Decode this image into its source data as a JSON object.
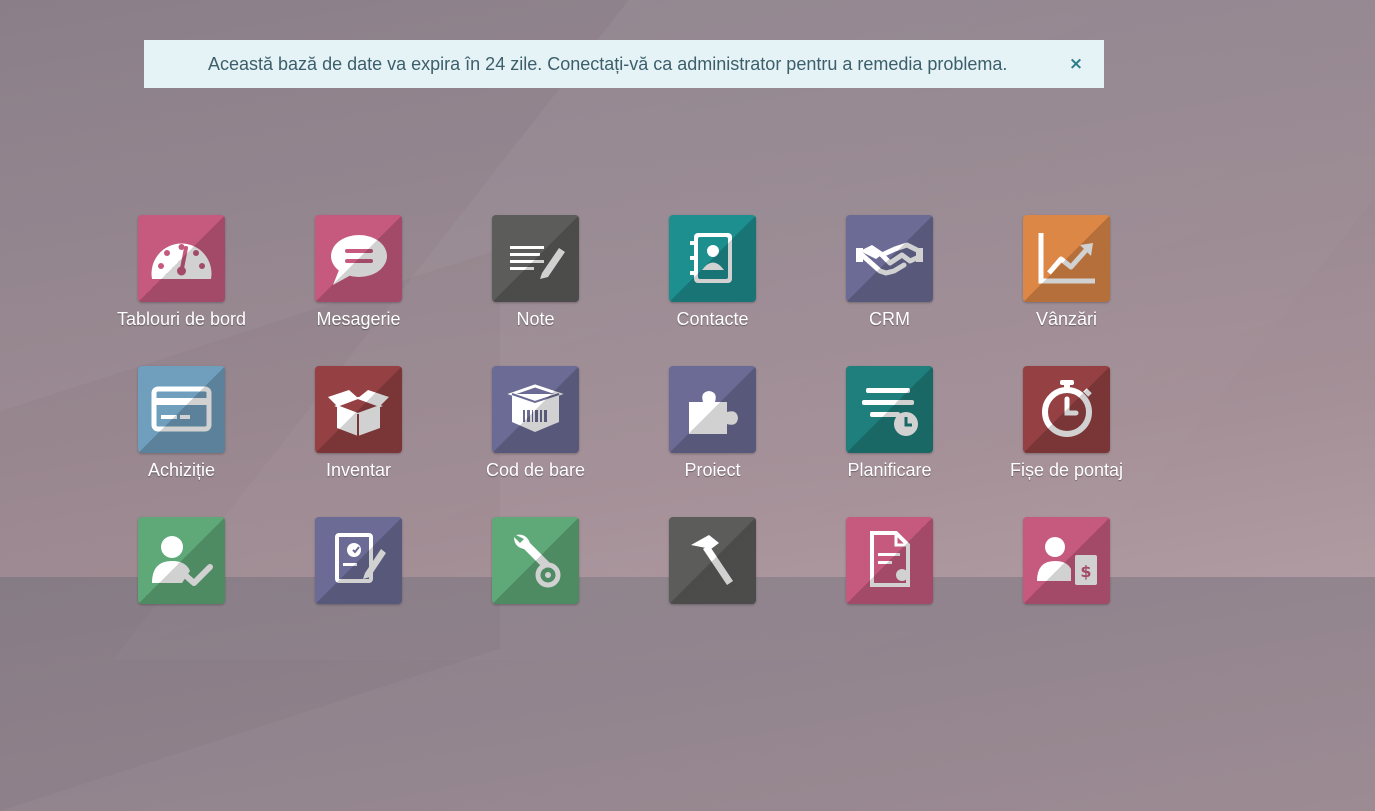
{
  "banner": {
    "message": "Această bază de date va expira în 24 zile. Conectați-vă ca administrator pentru a remedia problema.",
    "close_glyph": "×"
  },
  "apps": [
    {
      "label": "Tablouri de bord",
      "icon": "dashboard-gauge-icon",
      "color": "#c55a7e"
    },
    {
      "label": "Mesagerie",
      "icon": "chat-bubble-icon",
      "color": "#c55a7e"
    },
    {
      "label": "Note",
      "icon": "notes-pencil-icon",
      "color": "#5c5c5b"
    },
    {
      "label": "Contacte",
      "icon": "address-book-icon",
      "color": "#1e8f8f"
    },
    {
      "label": "CRM",
      "icon": "handshake-icon",
      "color": "#6b6b95"
    },
    {
      "label": "Vânzări",
      "icon": "trend-chart-icon",
      "color": "#dd8747"
    },
    {
      "label": "Achiziție",
      "icon": "credit-card-icon",
      "color": "#6f9fbc"
    },
    {
      "label": "Inventar",
      "icon": "open-box-icon",
      "color": "#954143"
    },
    {
      "label": "Cod de bare",
      "icon": "barcode-box-icon",
      "color": "#6b6b95"
    },
    {
      "label": "Proiect",
      "icon": "puzzle-piece-icon",
      "color": "#6b6b95"
    },
    {
      "label": "Planificare",
      "icon": "planning-clock-icon",
      "color": "#1e7f7d"
    },
    {
      "label": "Fișe de pontaj",
      "icon": "stopwatch-icon",
      "color": "#954143"
    },
    {
      "label": "",
      "icon": "user-check-icon",
      "color": "#5fa878"
    },
    {
      "label": "",
      "icon": "certificate-pen-icon",
      "color": "#6b6b95"
    },
    {
      "label": "",
      "icon": "wrench-gear-icon",
      "color": "#5fa878"
    },
    {
      "label": "",
      "icon": "hammer-icon",
      "color": "#5c5c5b"
    },
    {
      "label": "",
      "icon": "document-gear-icon",
      "color": "#c55a7e"
    },
    {
      "label": "",
      "icon": "user-invoice-icon",
      "color": "#c55a7e"
    }
  ]
}
